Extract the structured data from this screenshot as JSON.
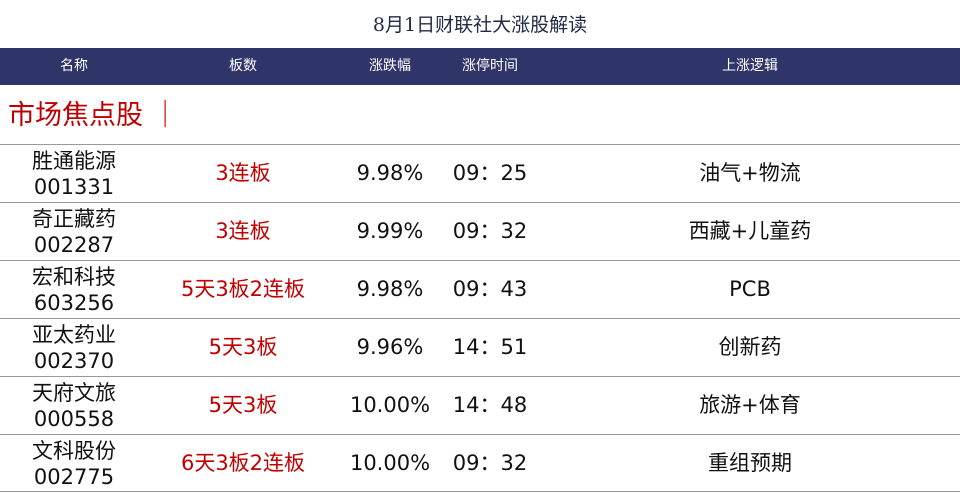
{
  "title": "8月1日财联社大涨股解读",
  "columns": {
    "name": "名称",
    "board": "板数",
    "change": "涨跌幅",
    "limit_time": "涨停时间",
    "logic": "上涨逻辑"
  },
  "section_label": "市场焦点股 ｜",
  "colors": {
    "header_bg": "#2f3569",
    "accent_red": "#c00000"
  },
  "rows": [
    {
      "name": "胜通能源",
      "code": "001331",
      "board": "3连板",
      "change": "9.98%",
      "time": "09：25",
      "logic": "油气+物流"
    },
    {
      "name": "奇正藏药",
      "code": "002287",
      "board": "3连板",
      "change": "9.99%",
      "time": "09：32",
      "logic": "西藏+儿童药"
    },
    {
      "name": "宏和科技",
      "code": "603256",
      "board": "5天3板2连板",
      "change": "9.98%",
      "time": "09：43",
      "logic": "PCB"
    },
    {
      "name": "亚太药业",
      "code": "002370",
      "board": "5天3板",
      "change": "9.96%",
      "time": "14：51",
      "logic": "创新药"
    },
    {
      "name": "天府文旅",
      "code": "000558",
      "board": "5天3板",
      "change": "10.00%",
      "time": "14：48",
      "logic": "旅游+体育"
    },
    {
      "name": "文科股份",
      "code": "002775",
      "board": "6天3板2连板",
      "change": "10.00%",
      "time": "09：32",
      "logic": "重组预期"
    }
  ]
}
